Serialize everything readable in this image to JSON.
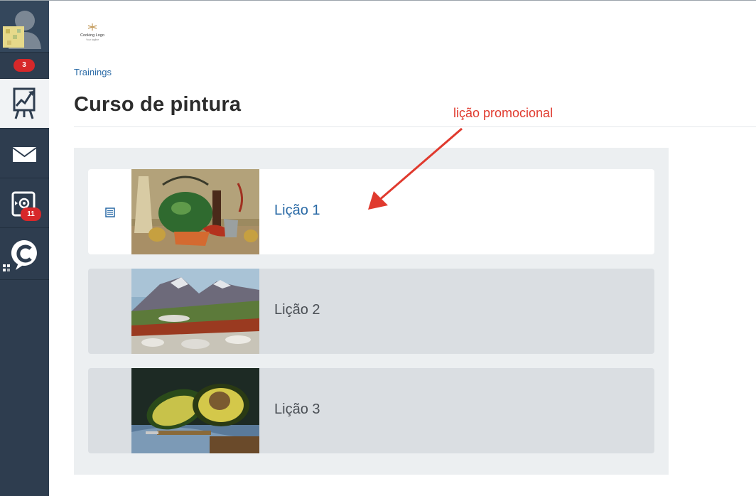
{
  "sidebar": {
    "notifications_badge": "3",
    "settings_badge": "11",
    "items": [
      {
        "icon": "presentation-chart-icon",
        "active": true
      },
      {
        "icon": "mail-icon"
      },
      {
        "icon": "settings-panel-icon"
      },
      {
        "icon": "chat-c-icon"
      }
    ]
  },
  "logo": {
    "line1": "Cooking Logo",
    "line2": "Your tagline"
  },
  "breadcrumb": "Trainings",
  "page_title": "Curso de pintura",
  "annotation": "lição promocional",
  "lessons": [
    {
      "title": "Lição 1",
      "promotional": true
    },
    {
      "title": "Lição 2",
      "promotional": false
    },
    {
      "title": "Lição 3",
      "promotional": false
    }
  ],
  "colors": {
    "sidebar": "#2e3d4f",
    "link": "#2a6aa6",
    "badge": "#d7282a",
    "annotation": "#e03a2e",
    "panel": "#eceff1"
  }
}
